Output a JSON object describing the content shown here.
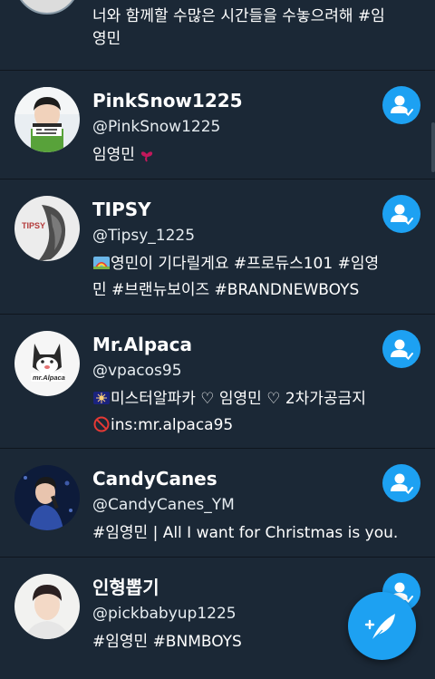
{
  "partial_row": {
    "bio_line1": "너와 함께할 수많은 시간들을 수놓으려해 #임",
    "bio_line2": "영민"
  },
  "accounts": [
    {
      "name": "PinkSnow1225",
      "handle": "@PinkSnow1225",
      "bio_lines": [
        "임영민"
      ],
      "bio_suffix_icon": "heart-emoji-icon",
      "follow_icon": "follow-person-icon"
    },
    {
      "name": "TIPSY",
      "handle": "@Tipsy_1225",
      "bio_lines": [
        "영민이 기다릴게요   #프로듀스101 #임영",
        "민 #브랜뉴보이즈 #BRANDNEWBOYS"
      ],
      "bio_prefix_icon": "rainbow-picture-emoji-icon",
      "avatar_text": "TIPSY",
      "follow_icon": "follow-person-icon"
    },
    {
      "name": "Mr.Alpaca",
      "handle": "@vpacos95",
      "bio_lines": [
        "미스터알파카 ♡ 임영민 ♡ 2차가공금지",
        "ins:mr.alpaca95"
      ],
      "bio_prefix_icon": "night-sky-emoji-icon",
      "bio_line2_prefix_icon": "prohibited-emoji-icon",
      "avatar_text": "mr.Alpaca",
      "follow_icon": "follow-person-icon"
    },
    {
      "name": "CandyCanes",
      "handle": "@CandyCanes_YM",
      "bio_lines": [
        "#임영민 | All I want for Christmas is you."
      ],
      "follow_icon": "follow-person-icon"
    },
    {
      "name": "인형뽑기",
      "handle": "@pickbabyup1225",
      "bio_lines": [
        "#임영민 #BNMBOYS"
      ],
      "follow_icon": "follow-person-icon"
    }
  ],
  "fab": {
    "icon": "compose-tweet-icon"
  },
  "colors": {
    "background": "#1b2836",
    "divider": "#0f161e",
    "accent": "#1da1f2",
    "text": "#ffffff"
  }
}
